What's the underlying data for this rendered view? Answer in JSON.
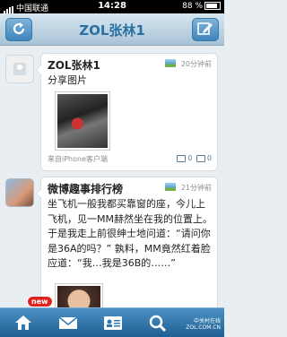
{
  "status": {
    "carrier": "中国联通",
    "time": "14:28",
    "battery": "88 %"
  },
  "nav": {
    "title": "ZOL张林1"
  },
  "posts": [
    {
      "author": "ZOL张林1",
      "time": "20分钟前",
      "text": "分享图片",
      "source": "来自iPhone客户端",
      "reposts": "0",
      "comments": "0"
    },
    {
      "author": "微博趣事排行榜",
      "time": "21分钟前",
      "text": "坐飞机一般我都买靠窗的座，今儿上飞机，见一MM赫然坐在我的位置上。于是我走上前很绅士地问道：“请问你是36A的吗？” 孰料，MM竟然红着脸应道：“我…我是36B的……”"
    }
  ],
  "tabbar": {
    "badge": "new"
  },
  "watermark": {
    "line1": "中关村在线",
    "line2": "ZOL.COM.CN"
  },
  "colors": {
    "navTitle": "#2a6fa0",
    "tabbar": "#2f77b0",
    "badge": "#e0231e"
  }
}
